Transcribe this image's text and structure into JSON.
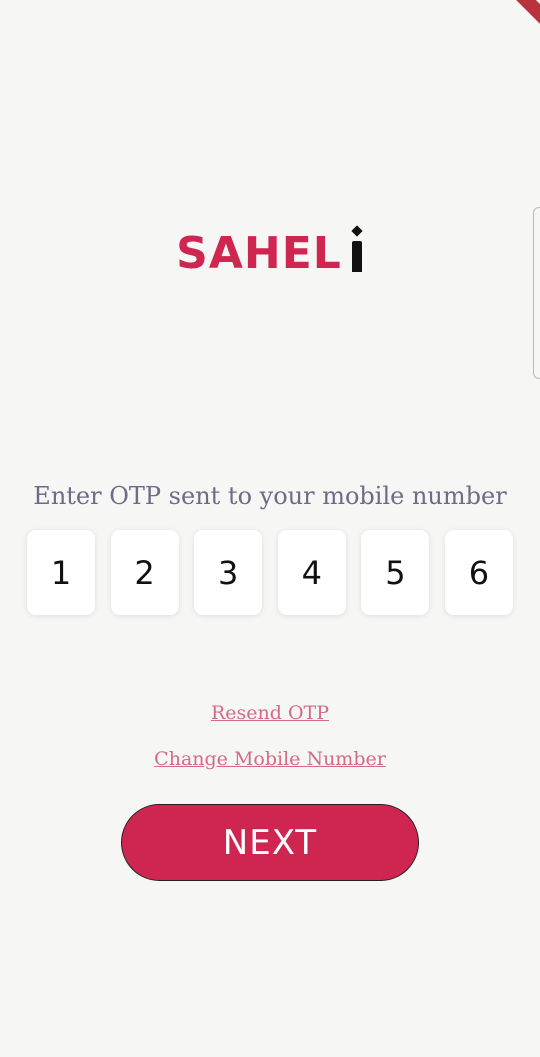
{
  "colors": {
    "background": "#f6f6f5",
    "brand": "#cf2651",
    "logo_mark": "#111111",
    "link": "#d46a85",
    "prompt_text": "#6c6c86"
  },
  "logo": {
    "text": "SAHEL",
    "mark_icon": "stylized-i-icon"
  },
  "otp": {
    "prompt": "Enter OTP sent to your mobile number",
    "digits": [
      "1",
      "2",
      "3",
      "4",
      "5",
      "6"
    ]
  },
  "links": {
    "resend": "Resend OTP",
    "change_number": "Change Mobile Number"
  },
  "actions": {
    "next_label": "NEXT"
  }
}
